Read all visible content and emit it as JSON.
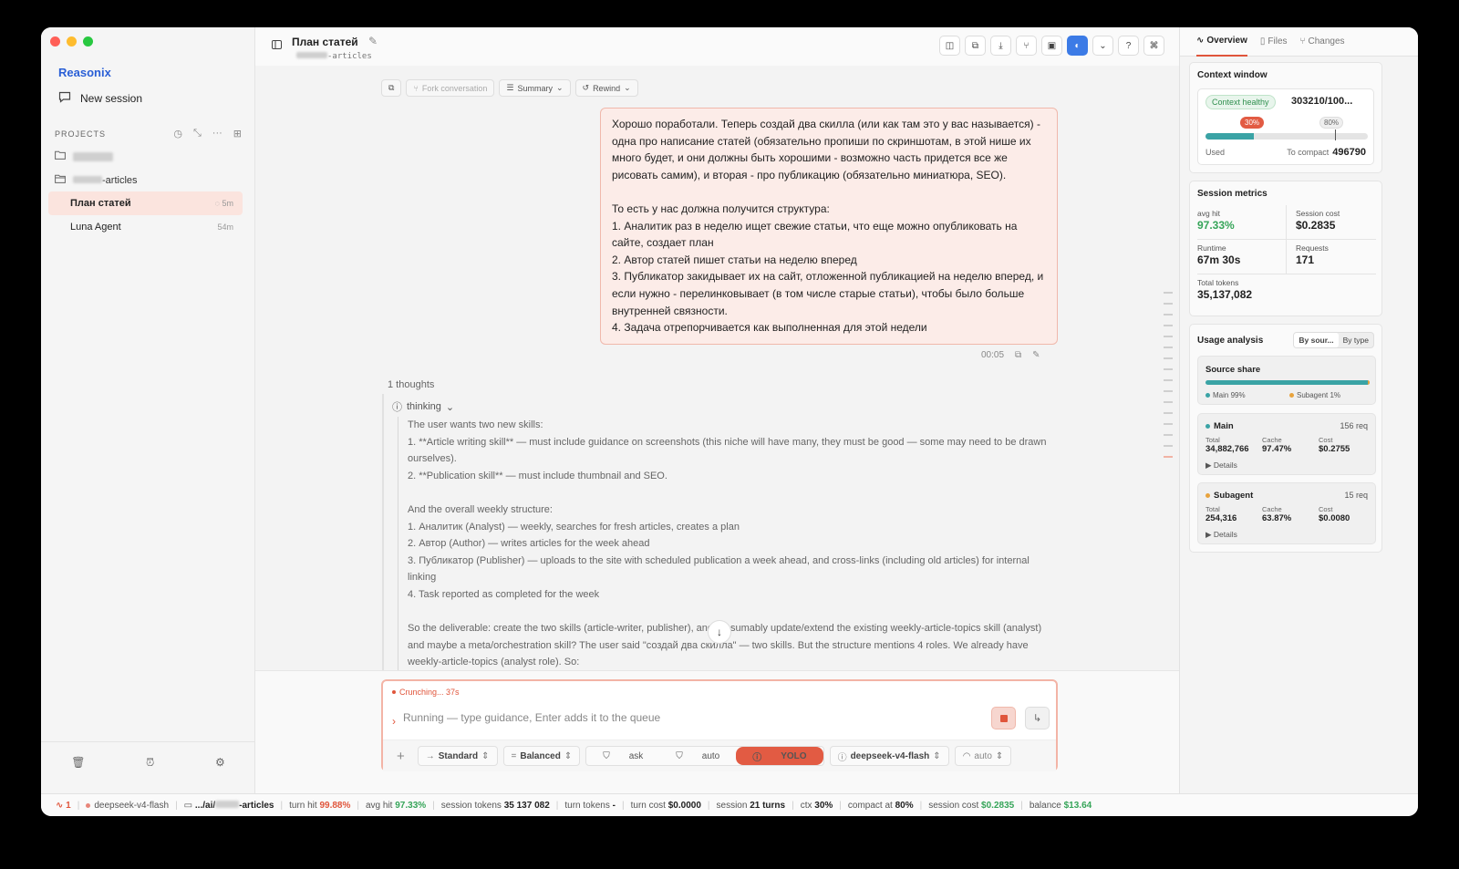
{
  "sidebar": {
    "brand": "Reasonix",
    "new_session": "New session",
    "projects_label": "PROJECTS",
    "project2_suffix": "-articles",
    "sessions": [
      {
        "title": "План статей",
        "age": "5m"
      },
      {
        "title": "Luna Agent",
        "age": "54m"
      }
    ]
  },
  "header": {
    "title": "План статей",
    "subpath_suffix": "-articles"
  },
  "convtools": {
    "fork": "Fork conversation",
    "summary": "Summary",
    "rewind": "Rewind"
  },
  "message": {
    "text": "Хорошо поработали. Теперь создай два скилла (или как там это у вас называется) - одна про написание статей (обязательно пропиши по скриншотам, в этой нише их много будет, и они должны быть хорошими - возможно часть придется все же рисовать самим), и вторая - про публикацию (обязательно миниатюра, SEO).\n\nТо есть у нас должна получится структура:\n1. Аналитик раз в неделю ищет свежие статьи, что еще можно опубликовать на сайте, создает план\n2. Автор статей пишет статьи на неделю вперед\n3. Публикатор закидывает их на сайт, отложенной публикацией на неделю вперед, и если нужно - перелинковывает (в том числе старые статьи), чтобы было больше внутренней связности.\n4. Задача отрепорчивается как выполненная для этой недели",
    "time": "00:05"
  },
  "thoughts": {
    "count_label": "1 thoughts",
    "header": "thinking",
    "text": "The user wants two new skills:\n1. **Article writing skill** — must include guidance on screenshots (this niche will have many, they must be good — some may need to be drawn ourselves).\n2. **Publication skill** — must include thumbnail and SEO.\n\nAnd the overall weekly structure:\n1. Аналитик (Analyst) — weekly, searches for fresh articles, creates a plan\n2. Автор (Author) — writes articles for the week ahead\n3. Публикатор (Publisher) — uploads to the site with scheduled publication a week ahead, and cross-links (including old articles) for internal linking\n4. Task reported as completed for the week\n\nSo the deliverable: create the two skills (article-writer, publisher), and presumably update/extend the existing weekly-article-topics skill (analyst) and maybe a meta/orchestration skill? The user said \"создай два скилла\" — two skills. But the structure mentions 4 roles. We already have weekly-article-topics (analyst role). So:"
  },
  "composer": {
    "status": "Crunching... 37s",
    "placeholder": "Running — type guidance, Enter adds it to the queue",
    "mode": "Standard",
    "effort": "Balanced",
    "perm_ask": "ask",
    "perm_auto": "auto",
    "perm_yolo": "YOLO",
    "model": "deepseek-v4-flash",
    "auto": "auto"
  },
  "rpanel": {
    "tabs": [
      "Overview",
      "Files",
      "Changes"
    ],
    "context": {
      "title": "Context window",
      "health": "Context healthy",
      "tokens": "303210/100...",
      "used_pct": "30%",
      "used_fraction": 0.3,
      "compact_pct": "80%",
      "compact_fraction": 0.8,
      "used_label": "Used",
      "to_compact_label": "To compact",
      "to_compact": "496790"
    },
    "metrics": {
      "title": "Session metrics",
      "avg_hit_label": "avg hit",
      "avg_hit": "97.33%",
      "cost_label": "Session cost",
      "cost": "$0.2835",
      "runtime_label": "Runtime",
      "runtime": "67m 30s",
      "requests_label": "Requests",
      "requests": "171",
      "tokens_label": "Total tokens",
      "tokens": "35,137,082"
    },
    "usage": {
      "title": "Usage analysis",
      "by_source": "By sour...",
      "by_type": "By type",
      "share_title": "Source share",
      "main_share": "Main 99%",
      "sub_share": "Subagent 1%",
      "sub_fraction": 0.01,
      "main": {
        "name": "Main",
        "req": "156 req",
        "total_label": "Total",
        "total": "34,882,766",
        "cache_label": "Cache",
        "cache": "97.47%",
        "cost_label": "Cost",
        "cost": "$0.2755",
        "details": "▶ Details"
      },
      "sub": {
        "name": "Subagent",
        "req": "15 req",
        "total_label": "Total",
        "total": "254,316",
        "cache_label": "Cache",
        "cache": "63.87%",
        "cost_label": "Cost",
        "cost": "$0.0080",
        "details": "▶ Details"
      }
    }
  },
  "status": {
    "count": "1",
    "model": "deepseek-v4-flash",
    "path_prefix": ".../ai/",
    "path_suffix": "-articles",
    "turn_hit_label": "turn hit",
    "turn_hit": "99.88%",
    "avg_hit_label": "avg hit",
    "avg_hit": "97.33%",
    "session_tokens_label": "session tokens",
    "session_tokens": "35 137 082",
    "turn_tokens_label": "turn tokens",
    "turn_tokens": "-",
    "turn_cost_label": "turn cost",
    "turn_cost": "$0.0000",
    "session_label": "session",
    "session_turns": "21 turns",
    "ctx_label": "ctx",
    "ctx": "30%",
    "compact_label": "compact at",
    "compact": "80%",
    "session_cost_label": "session cost",
    "session_cost": "$0.2835",
    "balance_label": "balance",
    "balance": "$13.64"
  },
  "colors": {
    "accent": "#e0553b",
    "brand": "#2a5fd6",
    "teal": "#3aa3a5",
    "green": "#36a559"
  }
}
